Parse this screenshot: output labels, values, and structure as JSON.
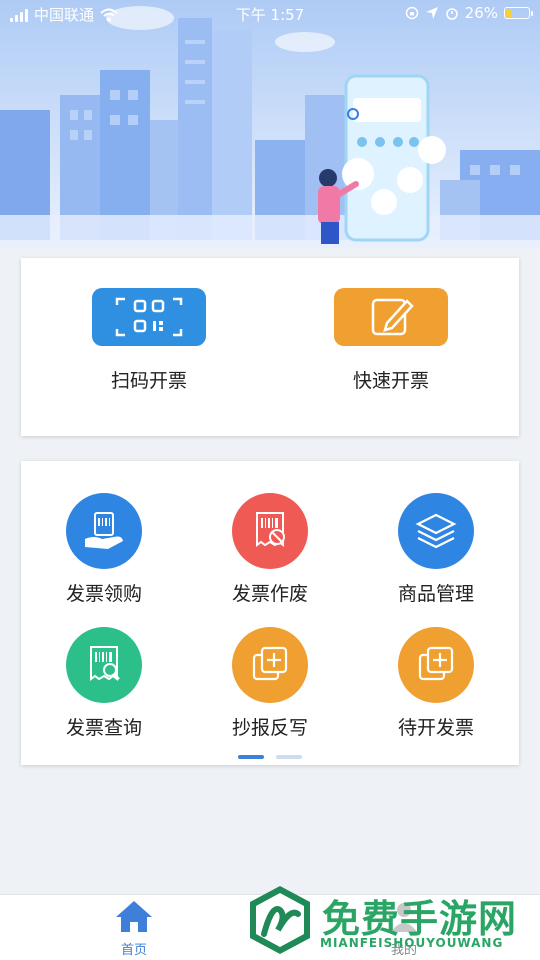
{
  "status_bar": {
    "carrier": "中国联通",
    "time": "下午 1:57",
    "battery": "26%",
    "battery_level": 0.26
  },
  "quick_actions": [
    {
      "label": "扫码开票",
      "icon": "qr-scan-icon",
      "color": "#2f8fe0"
    },
    {
      "label": "快速开票",
      "icon": "pencil-edit-icon",
      "color": "#f0a030"
    }
  ],
  "functions": [
    {
      "label": "发票领购",
      "icon": "invoice-hand-icon",
      "color": "#2f86e2"
    },
    {
      "label": "发票作废",
      "icon": "invoice-void-icon",
      "color": "#ef5a55"
    },
    {
      "label": "商品管理",
      "icon": "layers-icon",
      "color": "#2f86e2"
    },
    {
      "label": "发票查询",
      "icon": "invoice-search-icon",
      "color": "#2cbf8a"
    },
    {
      "label": "抄报反写",
      "icon": "copy-plus-icon",
      "color": "#f0a030"
    },
    {
      "label": "待开发票",
      "icon": "copy-plus-icon",
      "color": "#f0a030"
    }
  ],
  "pager": {
    "pages": 2,
    "active": 0,
    "active_color": "#3d7fd9",
    "inactive_color": "#cfdcf0"
  },
  "tabbar": [
    {
      "label": "首页",
      "icon": "home-icon",
      "active": true
    },
    {
      "label": "我的",
      "icon": "user-icon",
      "active": false
    }
  ],
  "watermark": {
    "title": "免费手游网",
    "subtitle": "MIANFEISHOUYOUWANG"
  }
}
